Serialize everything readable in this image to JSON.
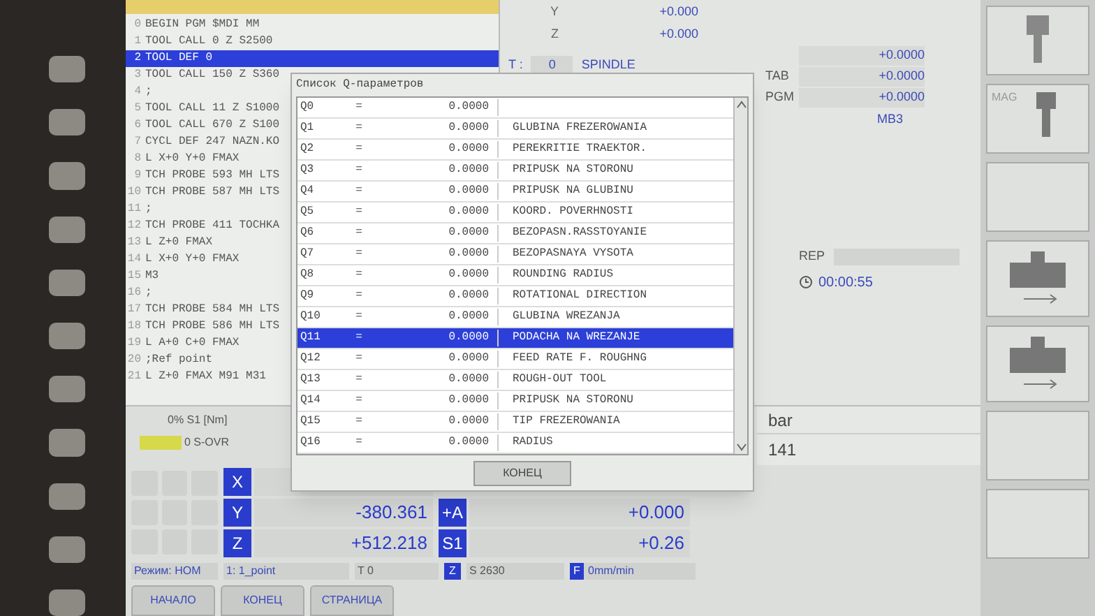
{
  "program": {
    "lines": [
      {
        "number": "0",
        "text": "BEGIN PGM $MDI MM",
        "selected": false
      },
      {
        "number": "1",
        "text": "TOOL CALL 0 Z S2500",
        "selected": false
      },
      {
        "number": "2",
        "text": "TOOL DEF 0",
        "selected": true
      },
      {
        "number": "3",
        "text": "TOOL CALL 150 Z S360",
        "selected": false
      },
      {
        "number": "4",
        "text": ";",
        "selected": false
      },
      {
        "number": "5",
        "text": "TOOL CALL 11 Z S1000",
        "selected": false
      },
      {
        "number": "6",
        "text": "TOOL CALL 670 Z S100",
        "selected": false
      },
      {
        "number": "7",
        "text": "CYCL DEF 247 NAZN.KO",
        "selected": false
      },
      {
        "number": "8",
        "text": "L X+0 Y+0 FMAX",
        "selected": false
      },
      {
        "number": "9",
        "text": "TCH PROBE 593 MH LTS",
        "selected": false
      },
      {
        "number": "10",
        "text": "TCH PROBE 587 MH LTS",
        "selected": false
      },
      {
        "number": "11",
        "text": ";",
        "selected": false
      },
      {
        "number": "12",
        "text": "TCH PROBE 411 TOCHKA",
        "selected": false
      },
      {
        "number": "13",
        "text": "L Z+0 FMAX",
        "selected": false
      },
      {
        "number": "14",
        "text": "L X+0 Y+0 FMAX",
        "selected": false
      },
      {
        "number": "15",
        "text": "M3",
        "selected": false
      },
      {
        "number": "16",
        "text": ";",
        "selected": false
      },
      {
        "number": "17",
        "text": "TCH PROBE 584 MH LTS",
        "selected": false
      },
      {
        "number": "18",
        "text": "TCH PROBE 586 MH LTS",
        "selected": false
      },
      {
        "number": "19",
        "text": "L A+0 C+0 FMAX",
        "selected": false
      },
      {
        "number": "20",
        "text": ";Ref point",
        "selected": false
      },
      {
        "number": "21",
        "text": "L Z+0 FMAX M91 M31",
        "selected": false
      }
    ]
  },
  "status": {
    "axes": [
      {
        "label": "Y",
        "value": "+0.000"
      },
      {
        "label": "Z",
        "value": "+0.000"
      }
    ],
    "tool_label": "T :",
    "tool_value": "0",
    "spindle": "SPINDLE"
  },
  "offsets": [
    {
      "value": "+0.0000"
    },
    {
      "label": "TAB",
      "value": "+0.0000"
    },
    {
      "label": "PGM",
      "value": "+0.0000"
    }
  ],
  "mode_code": "MB3",
  "rep_label": "REP",
  "run_time": "00:00:55",
  "pressure": {
    "unit": "bar",
    "value": "141"
  },
  "dialog": {
    "title": "Список Q-параметров",
    "button": "КОНЕЦ",
    "rows": [
      {
        "name": "Q0",
        "sign": "=",
        "value": "0.0000",
        "selected": false
      },
      {
        "name": "Q1",
        "sign": "=",
        "value": "0.0000",
        "description": "GLUBINA FREZEROWANIA",
        "selected": false
      },
      {
        "name": "Q2",
        "sign": "=",
        "value": "0.0000",
        "description": "PEREKRITIE TRAEKTOR.",
        "selected": false
      },
      {
        "name": "Q3",
        "sign": "=",
        "value": "0.0000",
        "description": "PRIPUSK NA STORONU",
        "selected": false
      },
      {
        "name": "Q4",
        "sign": "=",
        "value": "0.0000",
        "description": "PRIPUSK NA GLUBINU",
        "selected": false
      },
      {
        "name": "Q5",
        "sign": "=",
        "value": "0.0000",
        "description": "KOORD. POVERHNOSTI",
        "selected": false
      },
      {
        "name": "Q6",
        "sign": "=",
        "value": "0.0000",
        "description": "BEZOPASN.RASSTOYANIE",
        "selected": false
      },
      {
        "name": "Q7",
        "sign": "=",
        "value": "0.0000",
        "description": "BEZOPASNAYA VYSOTA",
        "selected": false
      },
      {
        "name": "Q8",
        "sign": "=",
        "value": "0.0000",
        "description": "ROUNDING RADIUS",
        "selected": false
      },
      {
        "name": "Q9",
        "sign": "=",
        "value": "0.0000",
        "description": "ROTATIONAL DIRECTION",
        "selected": false
      },
      {
        "name": "Q10",
        "sign": "=",
        "value": "0.0000",
        "description": "GLUBINA WREZANJA",
        "selected": false
      },
      {
        "name": "Q11",
        "sign": "=",
        "value": "0.0000",
        "description": "PODACHA NA WREZANJE",
        "selected": true
      },
      {
        "name": "Q12",
        "sign": "=",
        "value": "0.0000",
        "description": "FEED RATE F. ROUGHNG",
        "selected": false
      },
      {
        "name": "Q13",
        "sign": "=",
        "value": "0.0000",
        "description": "ROUGH-OUT TOOL",
        "selected": false
      },
      {
        "name": "Q14",
        "sign": "=",
        "value": "0.0000",
        "description": "PRIPUSK NA STORONU",
        "selected": false
      },
      {
        "name": "Q15",
        "sign": "=",
        "value": "0.0000",
        "description": "TIP FREZEROWANIA",
        "selected": false
      },
      {
        "name": "Q16",
        "sign": "=",
        "value": "0.0000",
        "description": "RADIUS",
        "selected": false
      }
    ]
  },
  "load": {
    "spindle": "0% S1 [Nm]",
    "override": "0 S-OVR"
  },
  "positions": [
    {
      "label": "X"
    },
    {
      "label": "Y",
      "value": "-380.361"
    },
    {
      "label": "Z",
      "value": "+512.218"
    }
  ],
  "aux_positions": [
    {
      "label": "+A",
      "value": "+0.000"
    },
    {
      "label": "S1",
      "value": "+0.26"
    }
  ],
  "info_row": {
    "mode": "Режим: НОМ",
    "preset": "1: 1_point",
    "tool": "T 0",
    "axis": "Z",
    "speed": "S 2630",
    "feed_label": "F",
    "feed": "0mm/min"
  },
  "softkeys": [
    "НАЧАЛО",
    "КОНЕЦ",
    "СТРАНИЦА"
  ],
  "side_panel": {
    "mag_label": "MAG"
  }
}
